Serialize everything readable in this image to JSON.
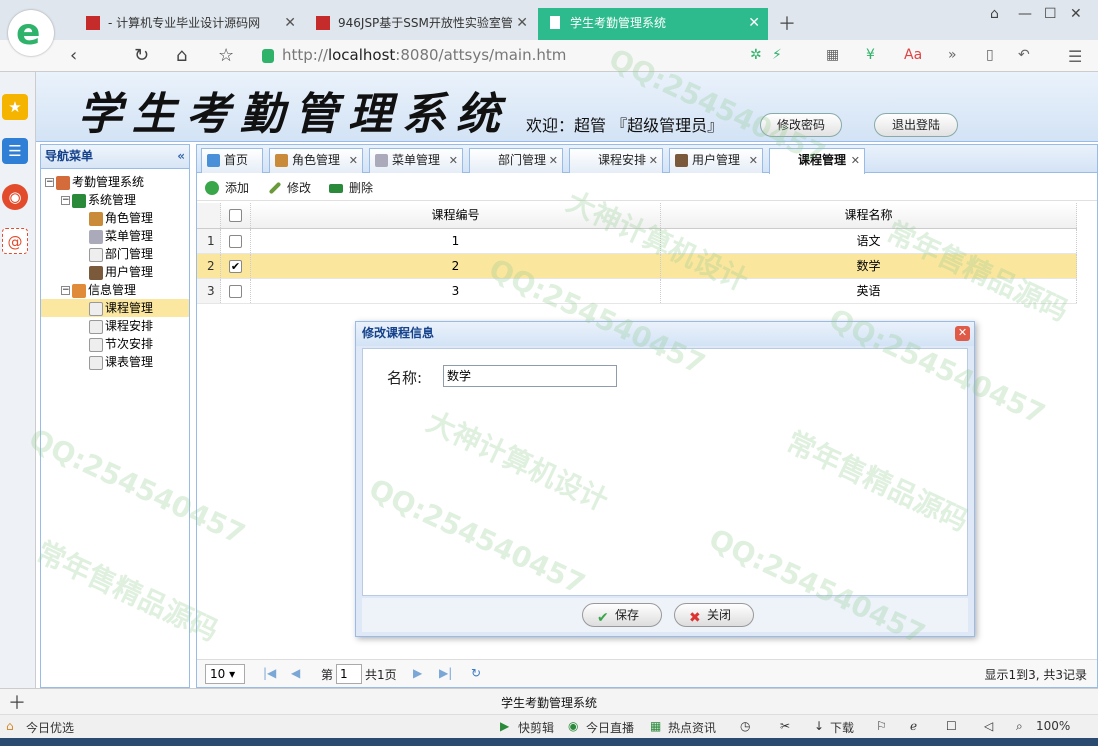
{
  "browser": {
    "tabs": [
      {
        "label": "- 计算机专业毕业设计源码网"
      },
      {
        "label": "946JSP基于SSM开放性实验室管"
      },
      {
        "label": "学生考勤管理系统"
      }
    ],
    "url_host": "localhost",
    "url_prefix": "http://",
    "url_rest": ":8080/attsys/main.htm"
  },
  "header": {
    "app_title": "学生考勤管理系统",
    "welcome": "欢迎：超管 『超级管理员』",
    "change_password": "修改密码",
    "logout": "退出登陆"
  },
  "nav": {
    "title": "导航菜单",
    "root": "考勤管理系统",
    "groups": [
      {
        "label": "系统管理",
        "items": [
          "角色管理",
          "菜单管理",
          "部门管理",
          "用户管理"
        ]
      },
      {
        "label": "信息管理",
        "items": [
          "课程管理",
          "课程安排",
          "节次安排",
          "课表管理"
        ]
      }
    ]
  },
  "tabs": [
    "首页",
    "角色管理",
    "菜单管理",
    "部门管理",
    "课程安排",
    "用户管理",
    "课程管理"
  ],
  "toolbar": {
    "add": "添加",
    "edit": "修改",
    "delete": "删除"
  },
  "grid": {
    "headers": [
      "课程编号",
      "课程名称"
    ],
    "rows": [
      {
        "num": "1",
        "id": "1",
        "name": "语文",
        "checked": false
      },
      {
        "num": "2",
        "id": "2",
        "name": "数学",
        "checked": true
      },
      {
        "num": "3",
        "id": "3",
        "name": "英语",
        "checked": false
      }
    ]
  },
  "pager": {
    "page_size": "10",
    "page_prefix": "第",
    "page": "1",
    "page_suffix": "共1页",
    "info": "显示1到3, 共3记录"
  },
  "modal": {
    "title": "修改课程信息",
    "name_label": "名称:",
    "name_value": "数学",
    "save": "保存",
    "close": "关闭"
  },
  "app_status": "学生考勤管理系统",
  "status_bar": {
    "left": "今日优选",
    "items": [
      "快剪辑",
      "今日直播",
      "热点资讯",
      "下载"
    ],
    "zoom": "100%"
  },
  "watermark": {
    "qq": "QQ:254540457",
    "t1": "大神计算机设计",
    "t2": "常年售精品源码"
  }
}
